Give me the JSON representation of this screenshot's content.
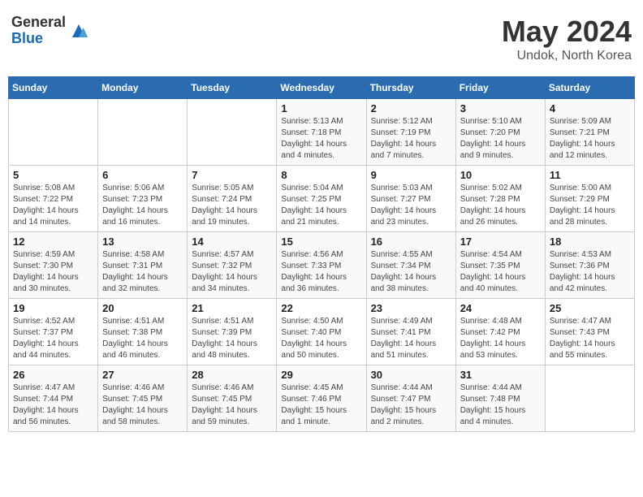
{
  "header": {
    "logo_general": "General",
    "logo_blue": "Blue",
    "month_title": "May 2024",
    "location": "Undok, North Korea"
  },
  "weekdays": [
    "Sunday",
    "Monday",
    "Tuesday",
    "Wednesday",
    "Thursday",
    "Friday",
    "Saturday"
  ],
  "weeks": [
    [
      {
        "day": "",
        "info": ""
      },
      {
        "day": "",
        "info": ""
      },
      {
        "day": "",
        "info": ""
      },
      {
        "day": "1",
        "info": "Sunrise: 5:13 AM\nSunset: 7:18 PM\nDaylight: 14 hours\nand 4 minutes."
      },
      {
        "day": "2",
        "info": "Sunrise: 5:12 AM\nSunset: 7:19 PM\nDaylight: 14 hours\nand 7 minutes."
      },
      {
        "day": "3",
        "info": "Sunrise: 5:10 AM\nSunset: 7:20 PM\nDaylight: 14 hours\nand 9 minutes."
      },
      {
        "day": "4",
        "info": "Sunrise: 5:09 AM\nSunset: 7:21 PM\nDaylight: 14 hours\nand 12 minutes."
      }
    ],
    [
      {
        "day": "5",
        "info": "Sunrise: 5:08 AM\nSunset: 7:22 PM\nDaylight: 14 hours\nand 14 minutes."
      },
      {
        "day": "6",
        "info": "Sunrise: 5:06 AM\nSunset: 7:23 PM\nDaylight: 14 hours\nand 16 minutes."
      },
      {
        "day": "7",
        "info": "Sunrise: 5:05 AM\nSunset: 7:24 PM\nDaylight: 14 hours\nand 19 minutes."
      },
      {
        "day": "8",
        "info": "Sunrise: 5:04 AM\nSunset: 7:25 PM\nDaylight: 14 hours\nand 21 minutes."
      },
      {
        "day": "9",
        "info": "Sunrise: 5:03 AM\nSunset: 7:27 PM\nDaylight: 14 hours\nand 23 minutes."
      },
      {
        "day": "10",
        "info": "Sunrise: 5:02 AM\nSunset: 7:28 PM\nDaylight: 14 hours\nand 26 minutes."
      },
      {
        "day": "11",
        "info": "Sunrise: 5:00 AM\nSunset: 7:29 PM\nDaylight: 14 hours\nand 28 minutes."
      }
    ],
    [
      {
        "day": "12",
        "info": "Sunrise: 4:59 AM\nSunset: 7:30 PM\nDaylight: 14 hours\nand 30 minutes."
      },
      {
        "day": "13",
        "info": "Sunrise: 4:58 AM\nSunset: 7:31 PM\nDaylight: 14 hours\nand 32 minutes."
      },
      {
        "day": "14",
        "info": "Sunrise: 4:57 AM\nSunset: 7:32 PM\nDaylight: 14 hours\nand 34 minutes."
      },
      {
        "day": "15",
        "info": "Sunrise: 4:56 AM\nSunset: 7:33 PM\nDaylight: 14 hours\nand 36 minutes."
      },
      {
        "day": "16",
        "info": "Sunrise: 4:55 AM\nSunset: 7:34 PM\nDaylight: 14 hours\nand 38 minutes."
      },
      {
        "day": "17",
        "info": "Sunrise: 4:54 AM\nSunset: 7:35 PM\nDaylight: 14 hours\nand 40 minutes."
      },
      {
        "day": "18",
        "info": "Sunrise: 4:53 AM\nSunset: 7:36 PM\nDaylight: 14 hours\nand 42 minutes."
      }
    ],
    [
      {
        "day": "19",
        "info": "Sunrise: 4:52 AM\nSunset: 7:37 PM\nDaylight: 14 hours\nand 44 minutes."
      },
      {
        "day": "20",
        "info": "Sunrise: 4:51 AM\nSunset: 7:38 PM\nDaylight: 14 hours\nand 46 minutes."
      },
      {
        "day": "21",
        "info": "Sunrise: 4:51 AM\nSunset: 7:39 PM\nDaylight: 14 hours\nand 48 minutes."
      },
      {
        "day": "22",
        "info": "Sunrise: 4:50 AM\nSunset: 7:40 PM\nDaylight: 14 hours\nand 50 minutes."
      },
      {
        "day": "23",
        "info": "Sunrise: 4:49 AM\nSunset: 7:41 PM\nDaylight: 14 hours\nand 51 minutes."
      },
      {
        "day": "24",
        "info": "Sunrise: 4:48 AM\nSunset: 7:42 PM\nDaylight: 14 hours\nand 53 minutes."
      },
      {
        "day": "25",
        "info": "Sunrise: 4:47 AM\nSunset: 7:43 PM\nDaylight: 14 hours\nand 55 minutes."
      }
    ],
    [
      {
        "day": "26",
        "info": "Sunrise: 4:47 AM\nSunset: 7:44 PM\nDaylight: 14 hours\nand 56 minutes."
      },
      {
        "day": "27",
        "info": "Sunrise: 4:46 AM\nSunset: 7:45 PM\nDaylight: 14 hours\nand 58 minutes."
      },
      {
        "day": "28",
        "info": "Sunrise: 4:46 AM\nSunset: 7:45 PM\nDaylight: 14 hours\nand 59 minutes."
      },
      {
        "day": "29",
        "info": "Sunrise: 4:45 AM\nSunset: 7:46 PM\nDaylight: 15 hours\nand 1 minute."
      },
      {
        "day": "30",
        "info": "Sunrise: 4:44 AM\nSunset: 7:47 PM\nDaylight: 15 hours\nand 2 minutes."
      },
      {
        "day": "31",
        "info": "Sunrise: 4:44 AM\nSunset: 7:48 PM\nDaylight: 15 hours\nand 4 minutes."
      },
      {
        "day": "",
        "info": ""
      }
    ]
  ]
}
